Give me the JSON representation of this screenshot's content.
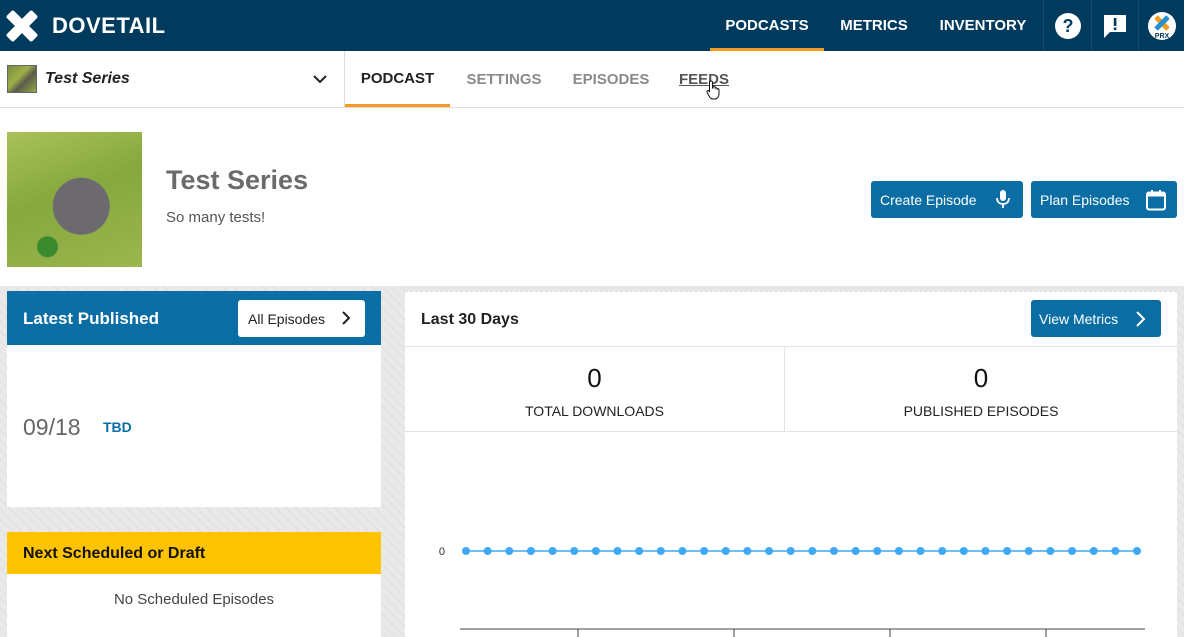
{
  "app": {
    "brand": "DOVETAIL",
    "accent_color": "#f39c1f",
    "navbar_color": "#003a5d",
    "primary_color": "#0a6ea5"
  },
  "topnav": {
    "items": [
      {
        "label": "PODCASTS",
        "active": true
      },
      {
        "label": "METRICS",
        "active": false
      },
      {
        "label": "INVENTORY",
        "active": false
      }
    ],
    "icons": [
      "help-icon",
      "feedback-icon",
      "prx-account-icon"
    ],
    "prx_label": "PRX"
  },
  "subnav": {
    "series_name": "Test Series",
    "tabs": [
      {
        "label": "PODCAST",
        "active": true
      },
      {
        "label": "SETTINGS",
        "active": false
      },
      {
        "label": "EPISODES",
        "active": false
      },
      {
        "label": "FEEDS",
        "active": false,
        "hovered": true
      }
    ]
  },
  "header": {
    "title": "Test Series",
    "subtitle": "So many tests!",
    "create_episode_label": "Create Episode",
    "plan_episodes_label": "Plan Episodes"
  },
  "latest_published": {
    "title": "Latest Published",
    "all_episodes_label": "All Episodes",
    "episode": {
      "date": "09/18",
      "title": "TBD"
    }
  },
  "next_scheduled": {
    "title": "Next Scheduled or Draft",
    "empty_text": "No Scheduled Episodes"
  },
  "metrics": {
    "title": "Last 30 Days",
    "view_metrics_label": "View Metrics",
    "total_downloads_value": "0",
    "total_downloads_label": "TOTAL DOWNLOADS",
    "published_episodes_value": "0",
    "published_episodes_label": "PUBLISHED EPISODES"
  },
  "chart_data": {
    "type": "line",
    "title": "",
    "xlabel": "",
    "ylabel": "",
    "y_tick_labels": [
      "0"
    ],
    "series": [
      {
        "values": [
          0,
          0,
          0,
          0,
          0,
          0,
          0,
          0,
          0,
          0,
          0,
          0,
          0,
          0,
          0,
          0,
          0,
          0,
          0,
          0,
          0,
          0,
          0,
          0,
          0,
          0,
          0,
          0,
          0,
          0,
          0,
          0
        ],
        "color": "#3fa9f5"
      }
    ],
    "grid": false
  }
}
